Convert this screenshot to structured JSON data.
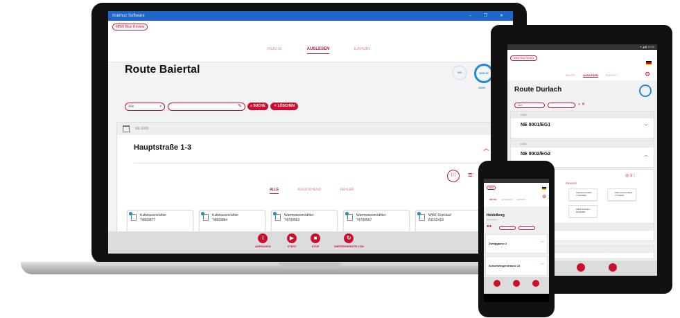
{
  "laptop": {
    "titlebar": "Itrakhuz Software",
    "window_controls": "– ❐ ✕",
    "brand": "MBW Blue Review",
    "tabs": [
      {
        "label": "ROUTE",
        "active": false
      },
      {
        "label": "AUSLESEN",
        "active": true
      },
      {
        "label": "EXPORT",
        "active": false
      }
    ],
    "page_title": "Route Baiertal",
    "ring_small": "0/0",
    "ring_main": "5/39 09",
    "ring_percent": "100%",
    "filter_select": "Alle",
    "search_placeholder": "",
    "suche_label": "SUCHE",
    "loeschen_label": "LÖSCHEN",
    "panel_header": "NE 0000",
    "address": "Hauptstraße 1-3",
    "filters": [
      {
        "label": "ALLE",
        "active": true
      },
      {
        "label": "AUSSTEHEND",
        "active": false
      },
      {
        "label": "FEHLER",
        "active": false
      }
    ],
    "meters": [
      {
        "type": "Kaltwasserzähler",
        "number": "74003877"
      },
      {
        "type": "Kaltwasserzähler",
        "number": "74003884"
      },
      {
        "type": "Warmwasserzähler",
        "number": "74700563"
      },
      {
        "type": "Warmwasserzähler",
        "number": "74700567"
      },
      {
        "type": "WMZ Rücklauf",
        "number": "81152418"
      }
    ],
    "actions": [
      {
        "label": "ANFRAGEN",
        "icon": "info-icon",
        "glyph": "i"
      },
      {
        "label": "START",
        "icon": "play-icon",
        "glyph": "▶"
      },
      {
        "label": "STOP",
        "icon": "stop-icon",
        "glyph": "■"
      },
      {
        "label": "WIEDERHERSTELLEN",
        "icon": "restore-icon",
        "glyph": "↻"
      }
    ]
  },
  "tablet": {
    "status": "▾ ◢ ▮ 12:30",
    "brand": "MBW Blue Review",
    "tabs": [
      {
        "label": "ROUTE",
        "active": false
      },
      {
        "label": "AUSLESEN",
        "active": true
      },
      {
        "label": "EXPORT",
        "active": false
      }
    ],
    "page_title": "Route Durlach",
    "filter_select": "Alle",
    "items": [
      {
        "header": "LBW",
        "name": "NE 0001/EG1"
      },
      {
        "header": "LBW",
        "name": "NE 0002/EG2"
      }
    ],
    "filters_label": "FEHLER",
    "meters": [
      {
        "type": "Kaltwasserzähler",
        "number": "774009881"
      },
      {
        "type": "Warmwasserzähler",
        "number": "77700030"
      },
      {
        "type": "WMZ Rücklauf",
        "number": "81240450"
      }
    ]
  },
  "phone": {
    "brand": "MBW",
    "tabs": [
      {
        "label": "ROUTE",
        "active": true
      },
      {
        "label": "AUSLESEN",
        "active": false
      },
      {
        "label": "EXPORT",
        "active": false
      }
    ],
    "page_title": "Heidelberg",
    "subtitle": "Neuenheim",
    "items": [
      {
        "name": "Zweiggasse 2",
        "sub": ""
      },
      {
        "name": "Schwetzingerstrasse 22",
        "sub": ""
      }
    ]
  },
  "colors": {
    "accent": "#c8102e",
    "progress": "#1e8ad6",
    "titlebar": "#1f66c6"
  }
}
